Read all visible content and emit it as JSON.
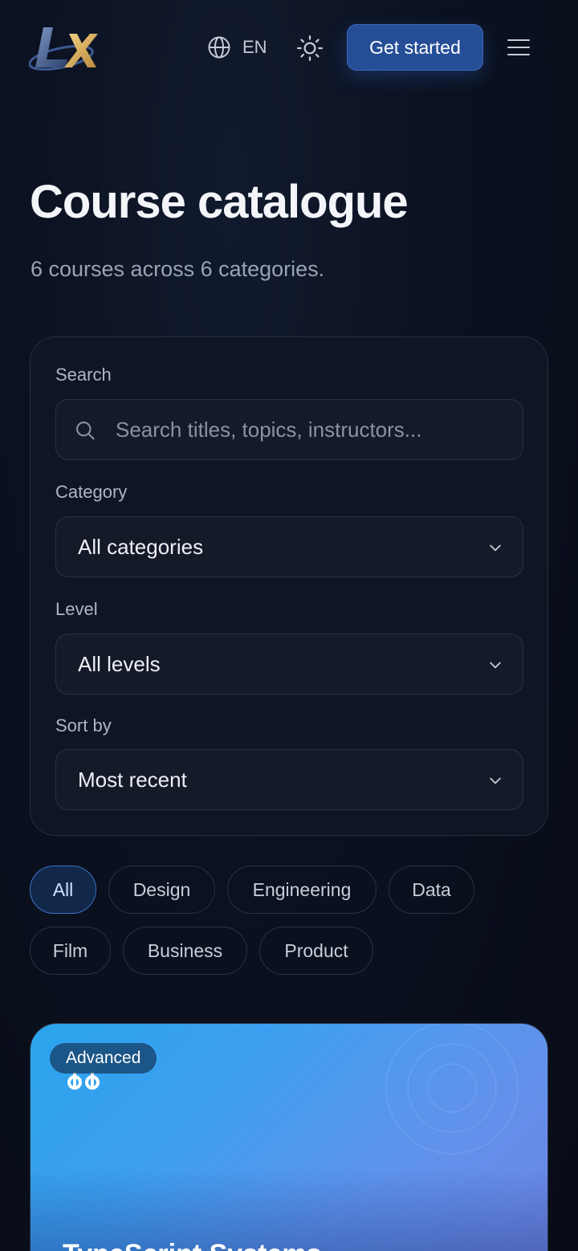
{
  "header": {
    "logo_text": "LX",
    "language": "EN",
    "cta_label": "Get started"
  },
  "page": {
    "title": "Course catalogue",
    "subtitle": "6 courses across 6 categories."
  },
  "filters": {
    "search_label": "Search",
    "search_placeholder": "Search titles, topics, instructors...",
    "search_value": "",
    "category_label": "Category",
    "category_value": "All categories",
    "level_label": "Level",
    "level_value": "All levels",
    "sort_label": "Sort by",
    "sort_value": "Most recent"
  },
  "chips": [
    {
      "label": "All",
      "active": true
    },
    {
      "label": "Design",
      "active": false
    },
    {
      "label": "Engineering",
      "active": false
    },
    {
      "label": "Data",
      "active": false
    },
    {
      "label": "Film",
      "active": false
    },
    {
      "label": "Business",
      "active": false
    },
    {
      "label": "Product",
      "active": false
    }
  ],
  "courses": [
    {
      "level": "Advanced",
      "title": "TypeScript Systems",
      "icon": "command-icon"
    }
  ],
  "colors": {
    "background": "#0b1120",
    "accent": "#254e97",
    "chip_active_border": "#3c72c9",
    "card_gradient_start": "#29a4ec",
    "card_gradient_end": "#6f85e3"
  }
}
